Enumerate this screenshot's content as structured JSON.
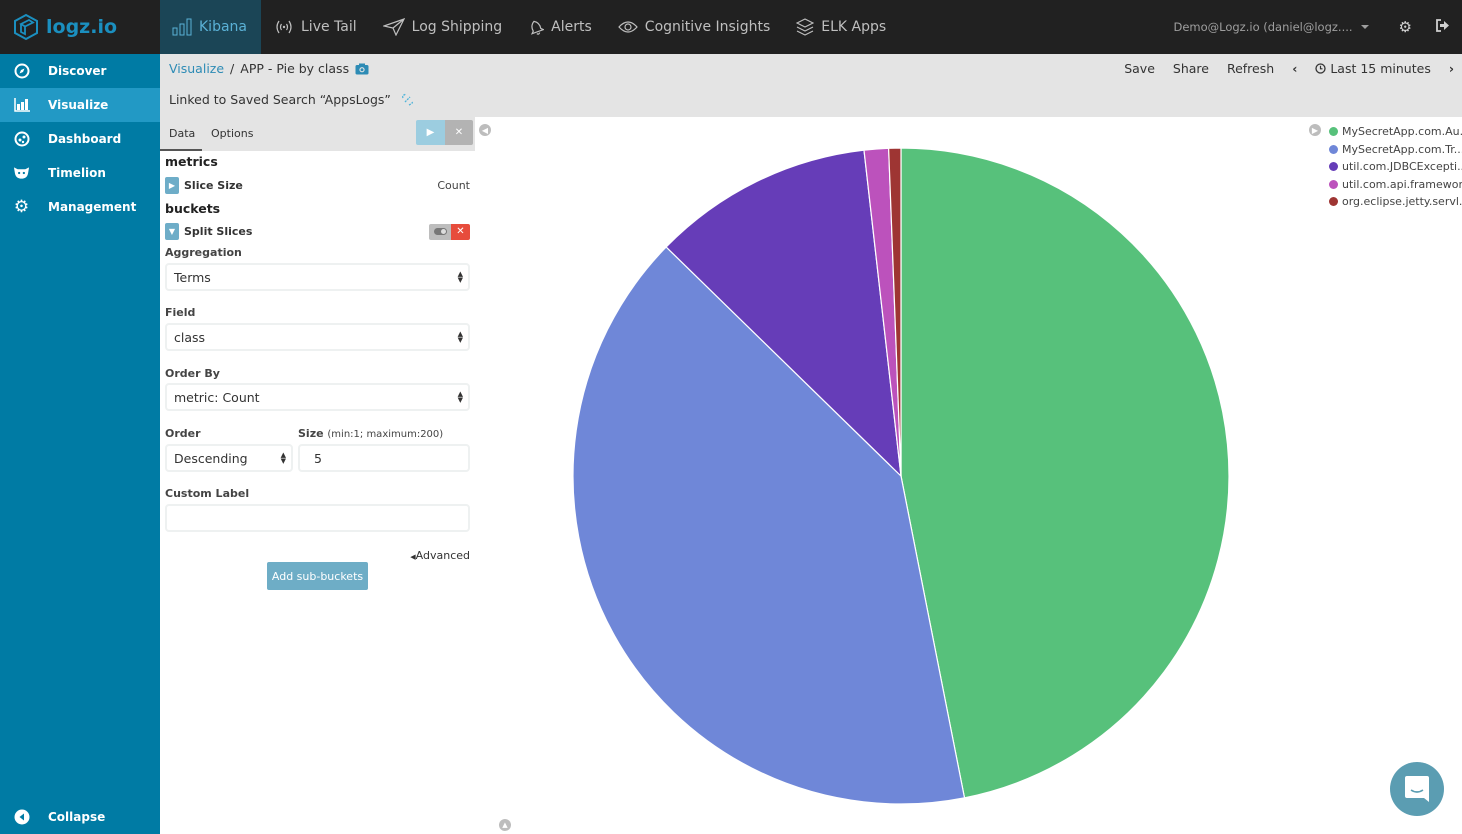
{
  "topbar": {
    "logo_text": "logz.io",
    "nav": [
      {
        "label": "Kibana",
        "icon": "bar-chart-icon",
        "active": true
      },
      {
        "label": "Live Tail",
        "icon": "broadcast-icon",
        "active": false
      },
      {
        "label": "Log Shipping",
        "icon": "paper-plane-icon",
        "active": false
      },
      {
        "label": "Alerts",
        "icon": "bell-icon",
        "active": false
      },
      {
        "label": "Cognitive Insights",
        "icon": "eye-icon",
        "active": false
      },
      {
        "label": "ELK Apps",
        "icon": "layers-icon",
        "active": false
      }
    ],
    "user": "Demo@Logz.io (daniel@logz....",
    "settings_icon": "gear-icon",
    "logout_icon": "logout-icon"
  },
  "sidebar": {
    "items": [
      {
        "label": "Discover",
        "icon": "compass-icon",
        "active": false
      },
      {
        "label": "Visualize",
        "icon": "bar-chart-icon",
        "active": true
      },
      {
        "label": "Dashboard",
        "icon": "dashboard-icon",
        "active": false
      },
      {
        "label": "Timelion",
        "icon": "timelion-icon",
        "active": false
      },
      {
        "label": "Management",
        "icon": "gear-icon",
        "active": false
      }
    ],
    "collapse_label": "Collapse"
  },
  "breadcrumb": {
    "root": "Visualize",
    "separator": "/",
    "current": "APP - Pie by class",
    "linked_search": "Linked to Saved Search “AppsLogs”"
  },
  "actions": {
    "save": "Save",
    "share": "Share",
    "refresh": "Refresh",
    "time_range": "Last 15 minutes"
  },
  "editor": {
    "tabs": [
      "Data",
      "Options"
    ],
    "metrics_title": "metrics",
    "metric": {
      "label": "Slice Size",
      "value": "Count"
    },
    "buckets_title": "buckets",
    "bucket": {
      "label": "Split Slices"
    },
    "aggregation": {
      "label": "Aggregation",
      "value": "Terms"
    },
    "field": {
      "label": "Field",
      "value": "class"
    },
    "order_by": {
      "label": "Order By",
      "value": "metric: Count"
    },
    "order": {
      "label": "Order",
      "value": "Descending"
    },
    "size": {
      "label": "Size",
      "hint": "(min:1; maximum:200)",
      "value": "5"
    },
    "custom_label": {
      "label": "Custom Label",
      "value": "",
      "placeholder": ""
    },
    "advanced": "Advanced",
    "add_sub_buckets": "Add sub-buckets"
  },
  "chart_data": {
    "type": "pie",
    "title": "",
    "legend_position": "top-right",
    "categories": [
      "MySecretApp.com.Au...",
      "MySecretApp.com.Tr...",
      "util.com.JDBCExcepti...",
      "util.com.api.framework",
      "org.eclipse.jetty.servl..."
    ],
    "values": [
      46.9,
      40.4,
      10.9,
      1.2,
      0.6
    ],
    "value_unit": "percent of count (estimated)",
    "colors": [
      "#57c17b",
      "#6f87d8",
      "#663db8",
      "#bc52bc",
      "#9e3533"
    ]
  }
}
